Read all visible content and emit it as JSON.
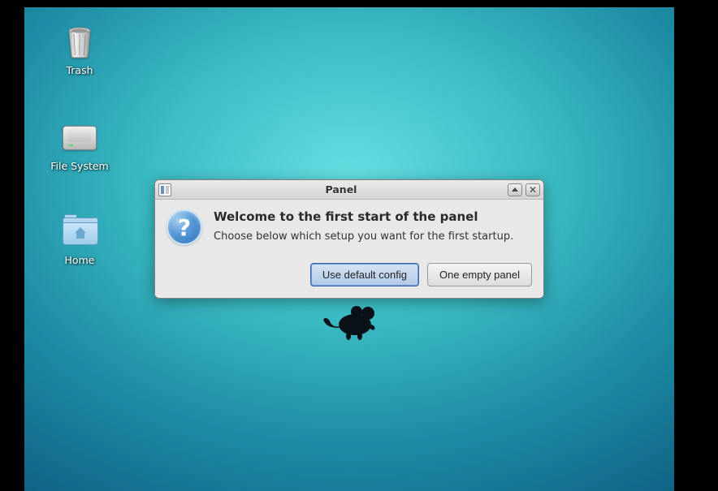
{
  "desktop": {
    "icons": {
      "trash": {
        "label": "Trash",
        "name": "trash-icon"
      },
      "filesystem": {
        "label": "File System",
        "name": "disk-icon"
      },
      "home": {
        "label": "Home",
        "name": "folder-home-icon"
      }
    },
    "logo": "xfce-mouse"
  },
  "dialog": {
    "title": "Panel",
    "icon": "panel-icon",
    "info_icon": "question-icon",
    "heading": "Welcome to the first start of the panel",
    "message": "Choose below which setup you want for the first startup.",
    "buttons": {
      "default_config": "Use default config",
      "empty_panel": "One empty panel"
    },
    "titlebar_buttons": {
      "rollup": "rollup",
      "close": "close"
    }
  },
  "colors": {
    "desktop_bg_start": "#65dee0",
    "desktop_bg_end": "#0d5e80",
    "dialog_bg": "#e8e8e8",
    "button_default_bg": "#b0c8e8"
  }
}
